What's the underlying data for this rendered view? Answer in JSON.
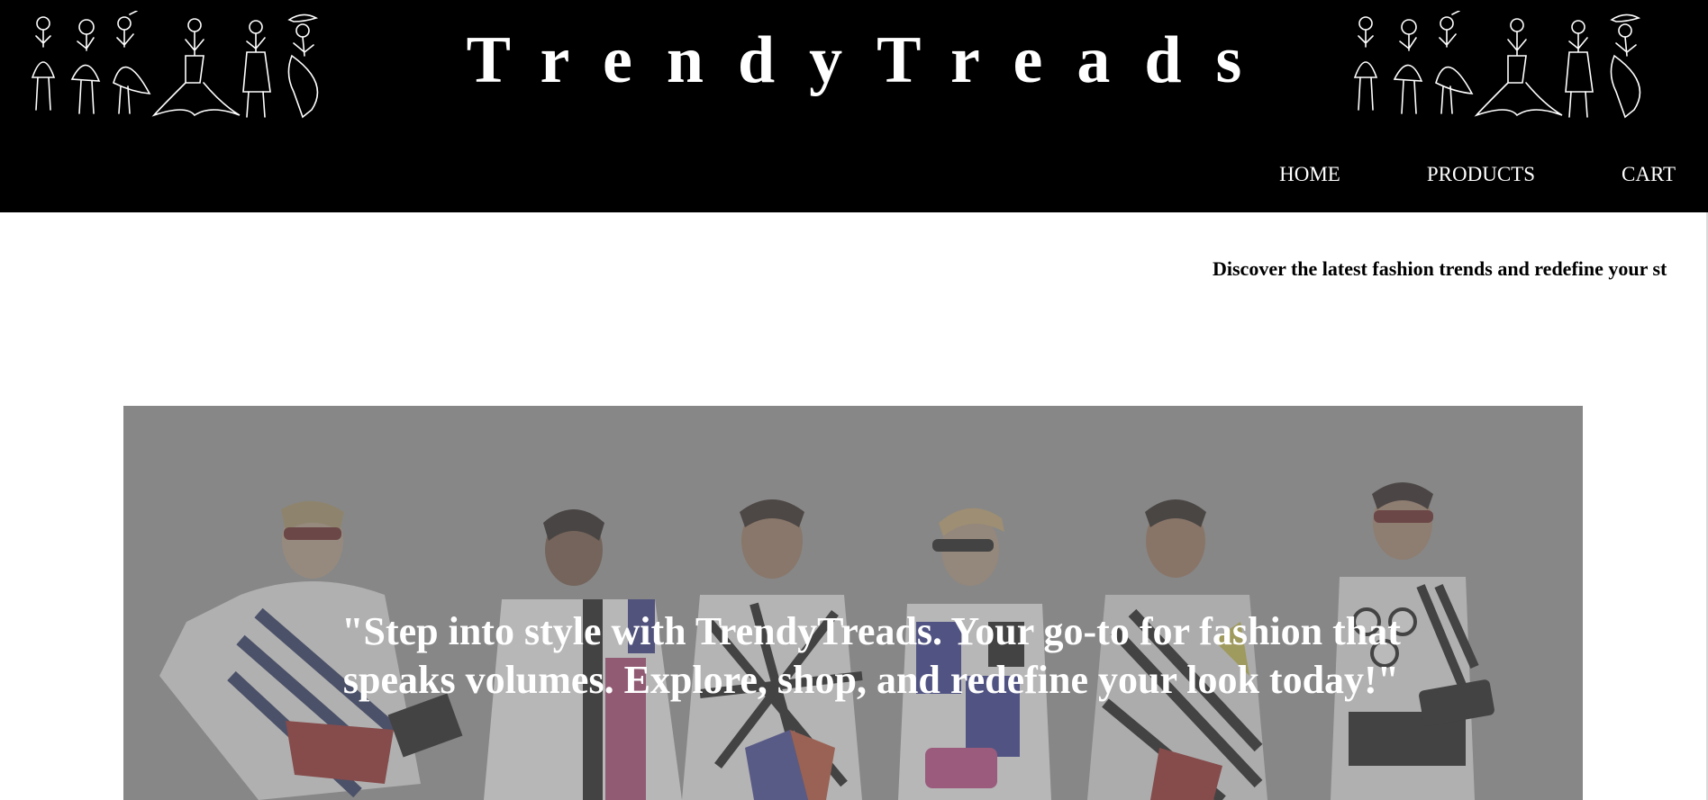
{
  "header": {
    "brand_title": "TrendyTreads",
    "left_sketch_icon": "fashion-sketch-icon",
    "right_sketch_icon": "fashion-sketch-icon",
    "background_color": "#000000",
    "text_color": "#ffffff"
  },
  "nav": {
    "items": [
      {
        "label": "HOME"
      },
      {
        "label": "PRODUCTS"
      },
      {
        "label": "CART"
      }
    ]
  },
  "tagline": {
    "text": "Discover the latest fashion trends and redefine your st"
  },
  "hero": {
    "quote": "\"Step into style with TrendyTreads. Your go-to for fashion that speaks volumes. Explore, shop, and redefine your look today!\"",
    "overlay_color": "#808080"
  }
}
